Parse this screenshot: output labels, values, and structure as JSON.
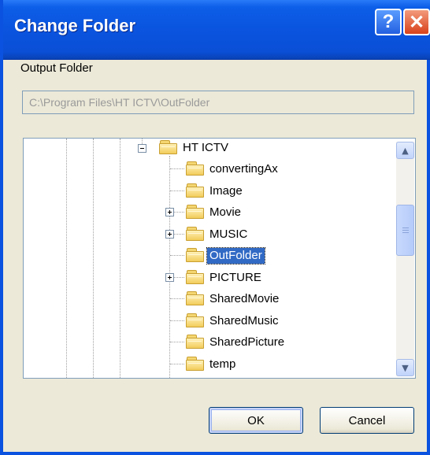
{
  "window": {
    "title": "Change Folder",
    "help_label": "?",
    "close_label": "✕"
  },
  "output": {
    "label": "Output Folder",
    "path": "C:\\Program Files\\HT ICTV\\OutFolder"
  },
  "tree": {
    "root_label": "HT ICTV",
    "items": [
      {
        "label": "convertingAx",
        "expandable": false
      },
      {
        "label": "Image",
        "expandable": false
      },
      {
        "label": "Movie",
        "expandable": true
      },
      {
        "label": "MUSIC",
        "expandable": true
      },
      {
        "label": "OutFolder",
        "expandable": false,
        "selected": true
      },
      {
        "label": "PICTURE",
        "expandable": true
      },
      {
        "label": "SharedMovie",
        "expandable": false
      },
      {
        "label": "SharedMusic",
        "expandable": false
      },
      {
        "label": "SharedPicture",
        "expandable": false
      },
      {
        "label": "temp",
        "expandable": false
      }
    ]
  },
  "buttons": {
    "ok": "OK",
    "cancel": "Cancel"
  },
  "colors": {
    "titlebar": "#0a54df",
    "selection": "#316ac5"
  }
}
